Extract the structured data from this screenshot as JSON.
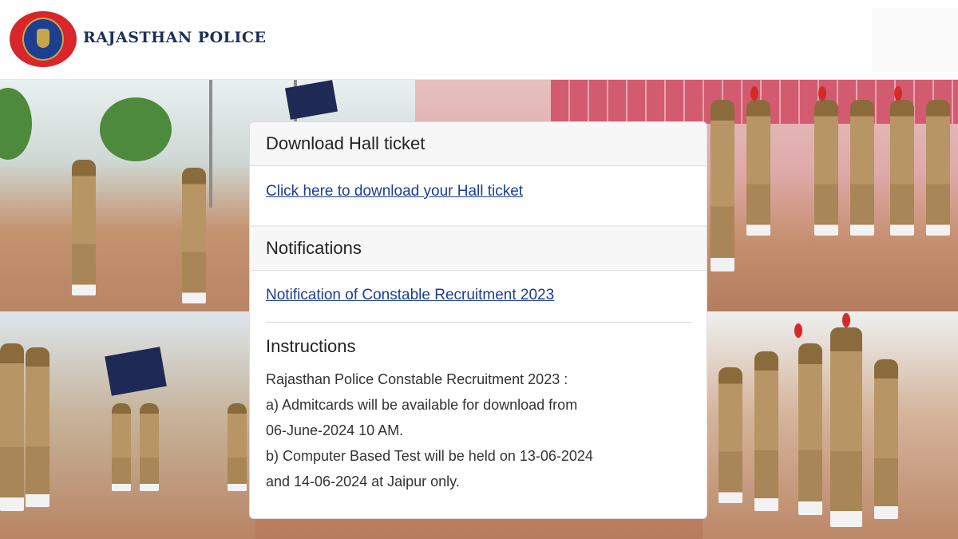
{
  "header": {
    "brand": "RAJASTHAN POLICE",
    "logo_icon": "rajasthan-police-emblem-icon"
  },
  "card": {
    "hall_ticket": {
      "title": "Download Hall ticket",
      "link": "Click here to download your Hall ticket"
    },
    "notifications": {
      "title": "Notifications",
      "link": "Notification of Constable Recruitment 2023"
    },
    "instructions": {
      "title": "Instructions",
      "lines": [
        "Rajasthan Police Constable Recruitment 2023 :",
        "a) Admitcards will be available for download from",
        "06-June-2024 10 AM.",
        "b) Computer Based Test will be held on 13-06-2024",
        "and 14-06-2024 at Jaipur only."
      ]
    }
  },
  "colors": {
    "link": "#1a3d95",
    "brand_text": "#1d2f5a",
    "logo_red": "#d8262a",
    "logo_blue": "#1d3f8f"
  }
}
